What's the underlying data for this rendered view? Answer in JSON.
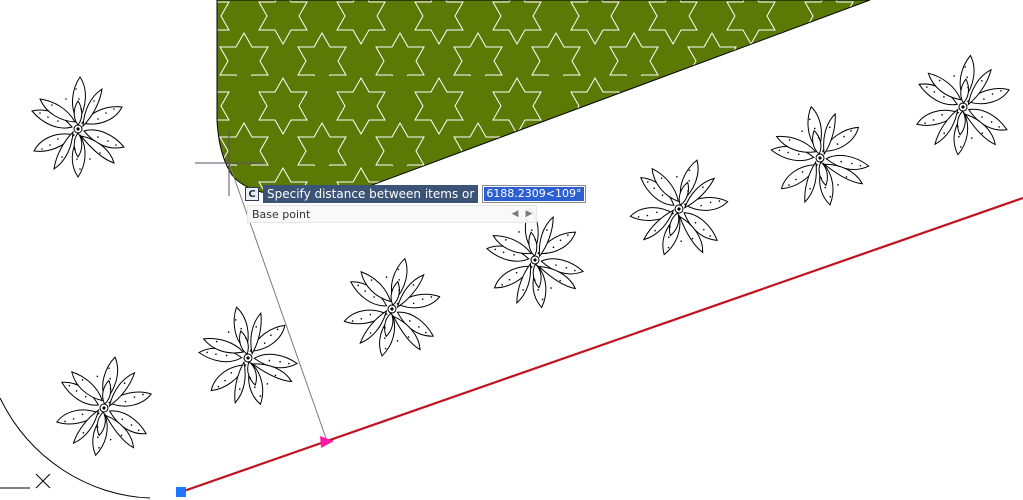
{
  "dynamic_input": {
    "command_icon": "C",
    "prompt": "Specify distance between items or",
    "value": "6188.2309<109°",
    "option": "Base point",
    "prev_icon": "◀",
    "next_icon": "▶"
  },
  "colors": {
    "hatch_fill": "#5a7a05",
    "hatch_pattern": "#ffffff",
    "path_line": "#c1121f",
    "grip": "#1f77ff",
    "arrow_grip": "#ff1aa8",
    "crosshair": "#5d4a66",
    "tooltip_bg": "#3b5375"
  },
  "icons": [
    "crosshair-cursor-icon",
    "plant-symbol-icon",
    "star-hatch-pattern",
    "grip-square-icon",
    "arrow-grip-icon"
  ]
}
